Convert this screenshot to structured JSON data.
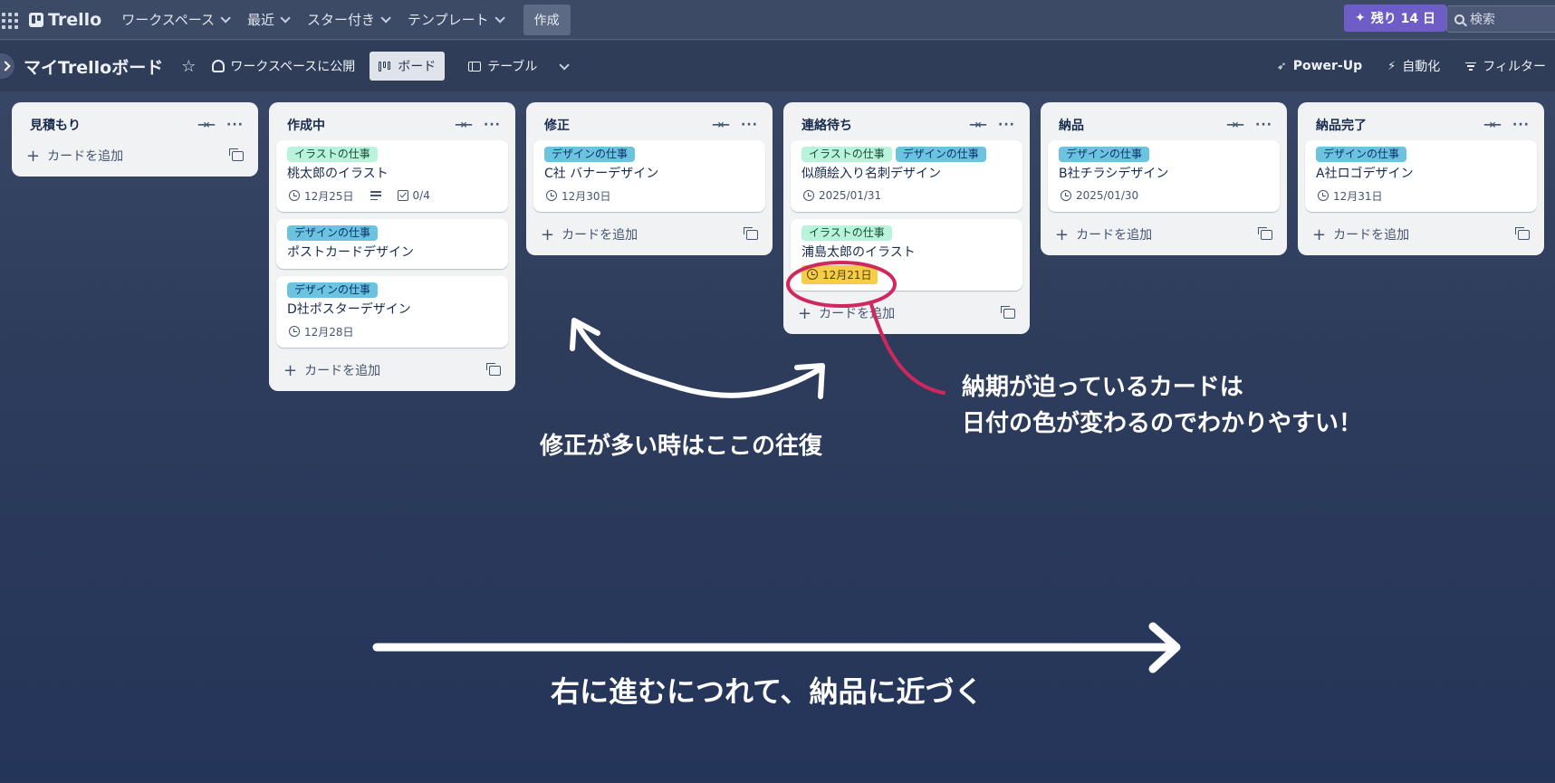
{
  "topnav": {
    "app_name": "Trello",
    "items": [
      {
        "label": "ワークスペース"
      },
      {
        "label": "最近"
      },
      {
        "label": "スター付き"
      },
      {
        "label": "テンプレート"
      }
    ],
    "create_label": "作成",
    "trial_label": "残り 14 日",
    "search_placeholder": "検索",
    "trial_color": "#6e5dc6"
  },
  "boardbar": {
    "title": "マイTrelloボード",
    "visibility_label": "ワークスペースに公開",
    "views": [
      {
        "label": "ボード",
        "active": true
      },
      {
        "label": "テーブル",
        "active": false
      }
    ],
    "actions": {
      "powerup_label": "Power-Up",
      "automation_label": "自動化",
      "filter_label": "フィルター"
    }
  },
  "add_card_label": "カードを追加",
  "lists": [
    {
      "title": "見積もり",
      "cards": []
    },
    {
      "title": "作成中",
      "cards": [
        {
          "labels": [
            "イラストの仕事"
          ],
          "title": "桃太郎のイラスト",
          "due": "12月25日",
          "has_description": true,
          "checklist": "0/4"
        },
        {
          "labels": [
            "デザインの仕事"
          ],
          "title": "ポストカードデザイン"
        },
        {
          "labels": [
            "デザインの仕事"
          ],
          "title": "D社ポスターデザイン",
          "due": "12月28日"
        }
      ]
    },
    {
      "title": "修正",
      "cards": [
        {
          "labels": [
            "デザインの仕事"
          ],
          "title": "C社 バナーデザイン",
          "due": "12月30日"
        }
      ]
    },
    {
      "title": "連絡待ち",
      "cards": [
        {
          "labels": [
            "イラストの仕事",
            "デザインの仕事"
          ],
          "title": "似顔絵入り名刺デザイン",
          "due": "2025/01/31"
        },
        {
          "labels": [
            "イラストの仕事"
          ],
          "title": "浦島太郎のイラスト",
          "due": "12月21日",
          "due_soon": true
        }
      ]
    },
    {
      "title": "納品",
      "cards": [
        {
          "labels": [
            "デザインの仕事"
          ],
          "title": "B社チラシデザイン",
          "due": "2025/01/30"
        }
      ]
    },
    {
      "title": "納品完了",
      "cards": [
        {
          "labels": [
            "デザインの仕事"
          ],
          "title": "A社ロゴデザイン",
          "due": "12月31日"
        }
      ]
    }
  ],
  "annotations": {
    "revision_loop": "修正が多い時はここの往復",
    "due_note_line1": "納期が迫っているカードは",
    "due_note_line2": "日付の色が変わるのでわかりやすい！",
    "progress_note": "右に進むにつれて、納品に近づく"
  },
  "colors": {
    "illust_label": "#baf3db",
    "design_label": "#6cc3e0",
    "due_soon": "#f5cd47",
    "highlight_circle": "#d0285e"
  }
}
